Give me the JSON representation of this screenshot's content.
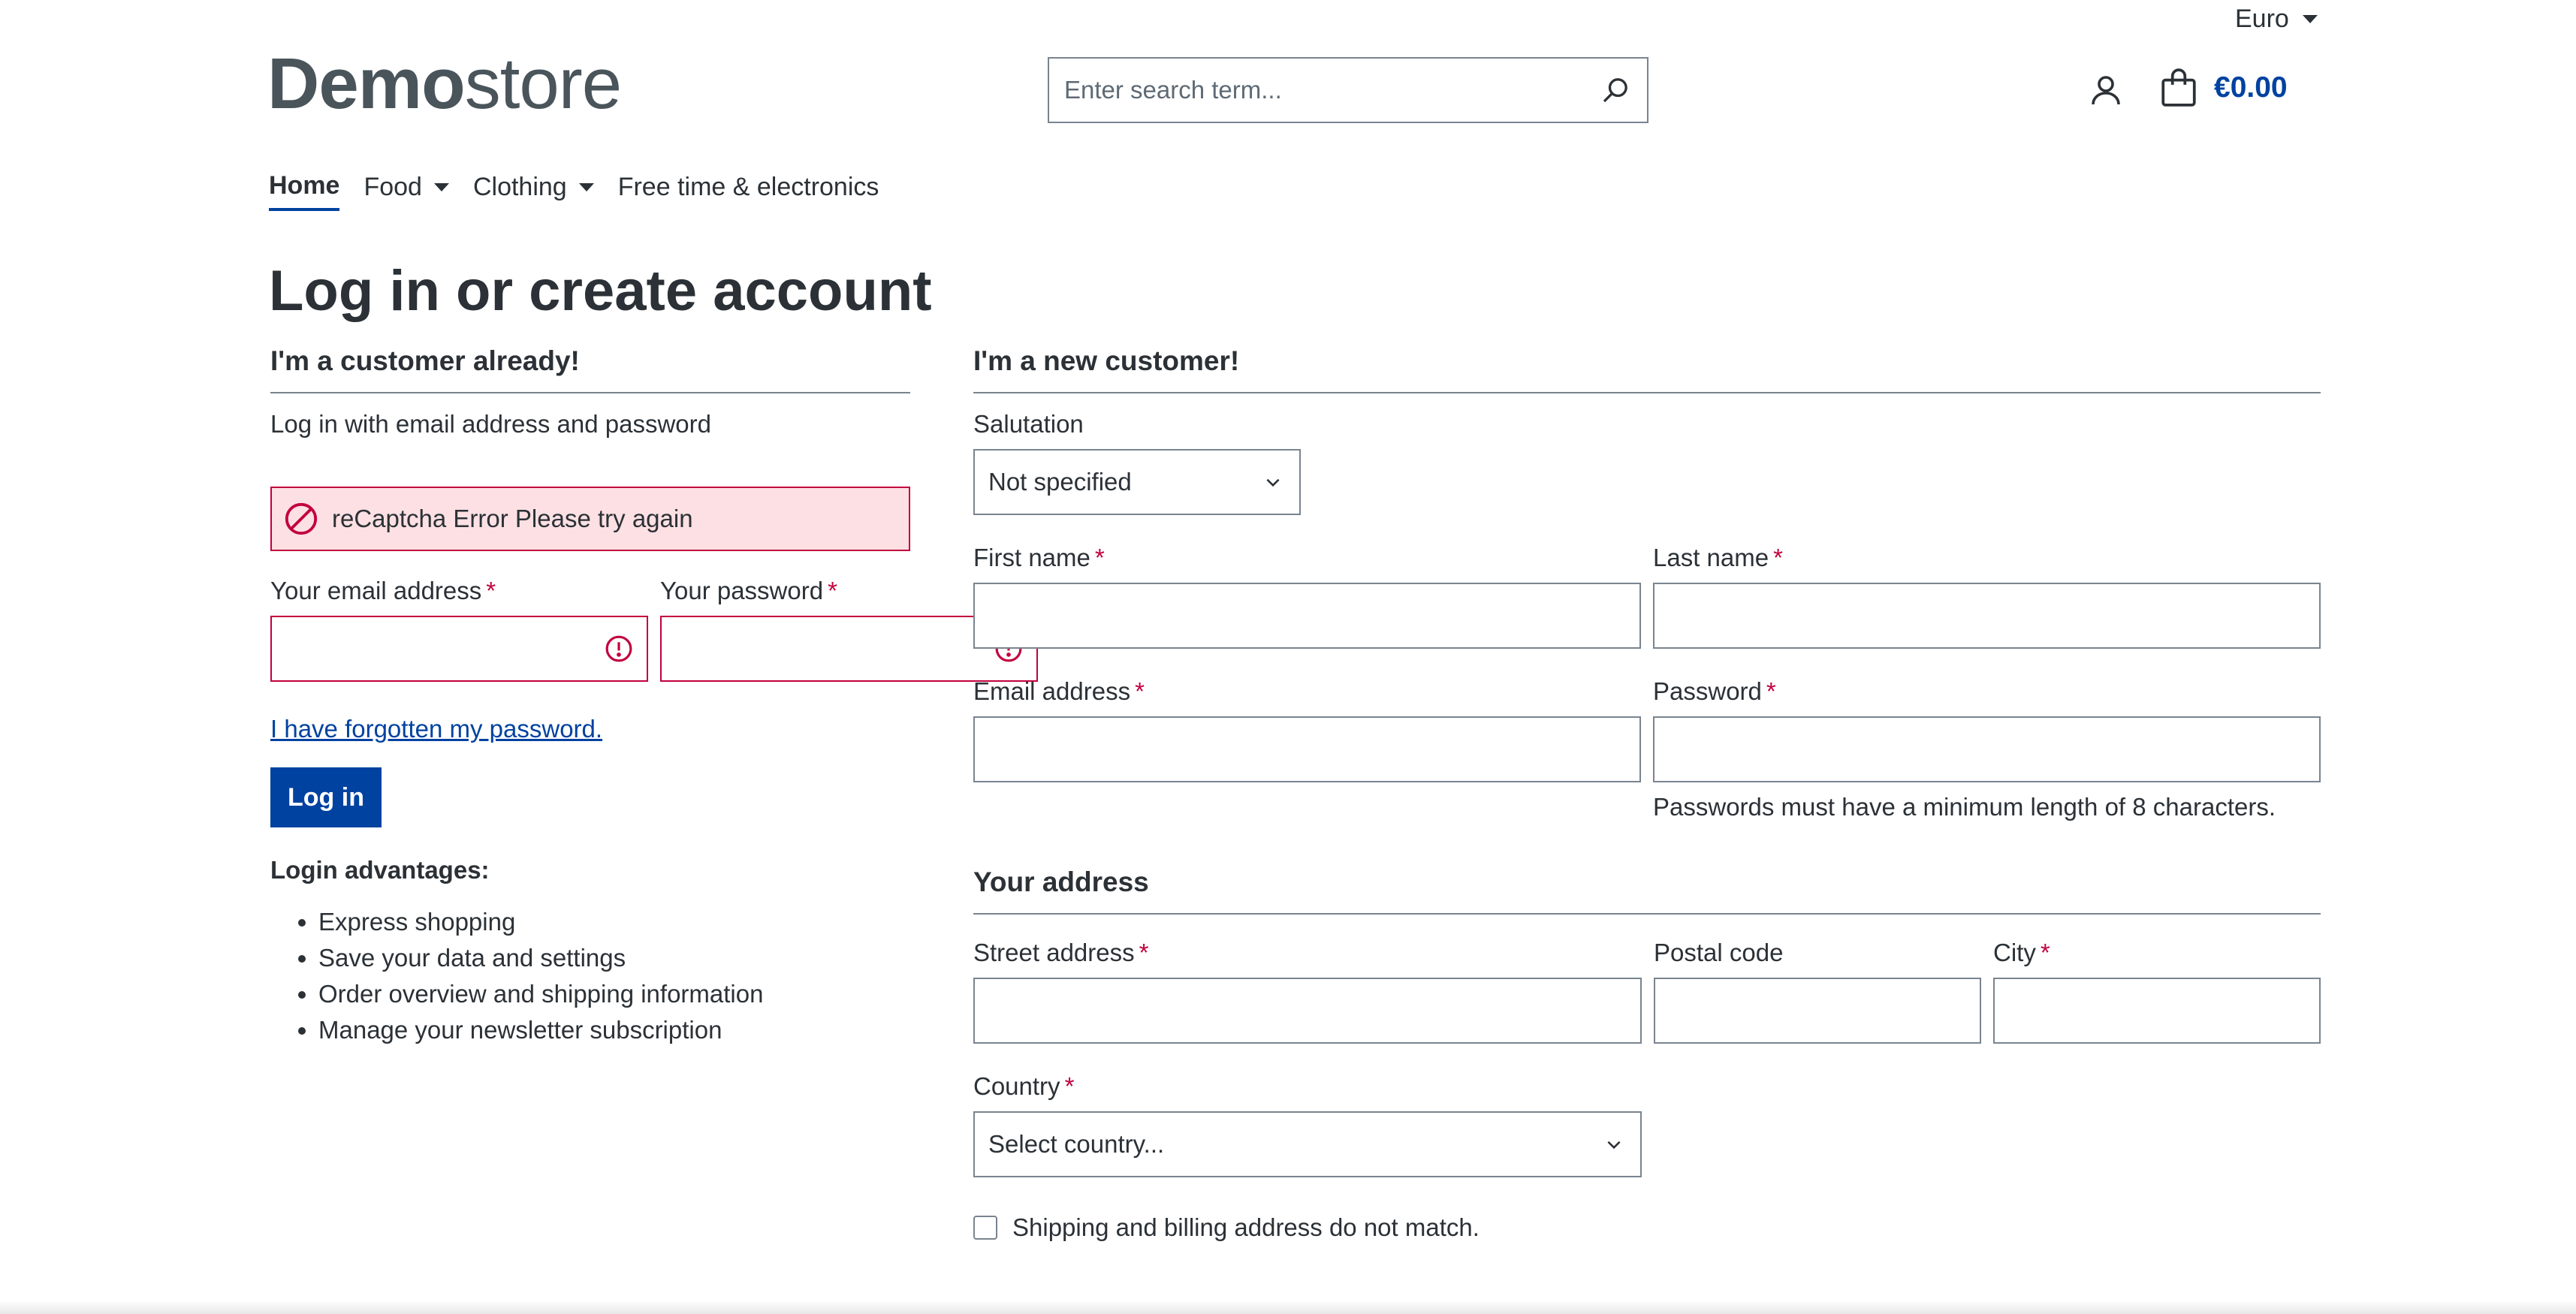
{
  "header": {
    "currency": "Euro",
    "logo_bold": "Demo",
    "logo_light": "store",
    "search_placeholder": "Enter search term...",
    "cart_total": "€0.00"
  },
  "nav": {
    "items": [
      {
        "label": "Home",
        "active": true,
        "dropdown": false
      },
      {
        "label": "Food",
        "dropdown": true
      },
      {
        "label": "Clothing",
        "dropdown": true
      },
      {
        "label": "Free time & electronics",
        "dropdown": false
      }
    ]
  },
  "page_title": "Log in or create account",
  "login": {
    "title": "I'm a customer already!",
    "subtitle": "Log in with email address and password",
    "alert": "reCaptcha Error Please try again",
    "email_label": "Your email address",
    "password_label": "Your password",
    "required_mark": "*",
    "forgot_link": "I have forgotten my password.",
    "submit": "Log in",
    "advantages_title": "Login advantages:",
    "advantages": [
      "Express shopping",
      "Save your data and settings",
      "Order overview and shipping information",
      "Manage your newsletter subscription"
    ]
  },
  "register": {
    "title": "I'm a new customer!",
    "salutation_label": "Salutation",
    "salutation_value": "Not specified",
    "first_name_label": "First name",
    "last_name_label": "Last name",
    "email_label": "Email address",
    "password_label": "Password",
    "password_hint": "Passwords must have a minimum length of 8 characters.",
    "address_title": "Your address",
    "street_label": "Street address",
    "postal_label": "Postal code",
    "city_label": "City",
    "country_label": "Country",
    "country_value": "Select country...",
    "different_address": "Shipping and billing address do not match."
  },
  "colors": {
    "primary": "#0042a0",
    "error": "#c2003d",
    "alert_bg": "#fde0e3",
    "border": "#798490",
    "text": "#2b3136"
  }
}
